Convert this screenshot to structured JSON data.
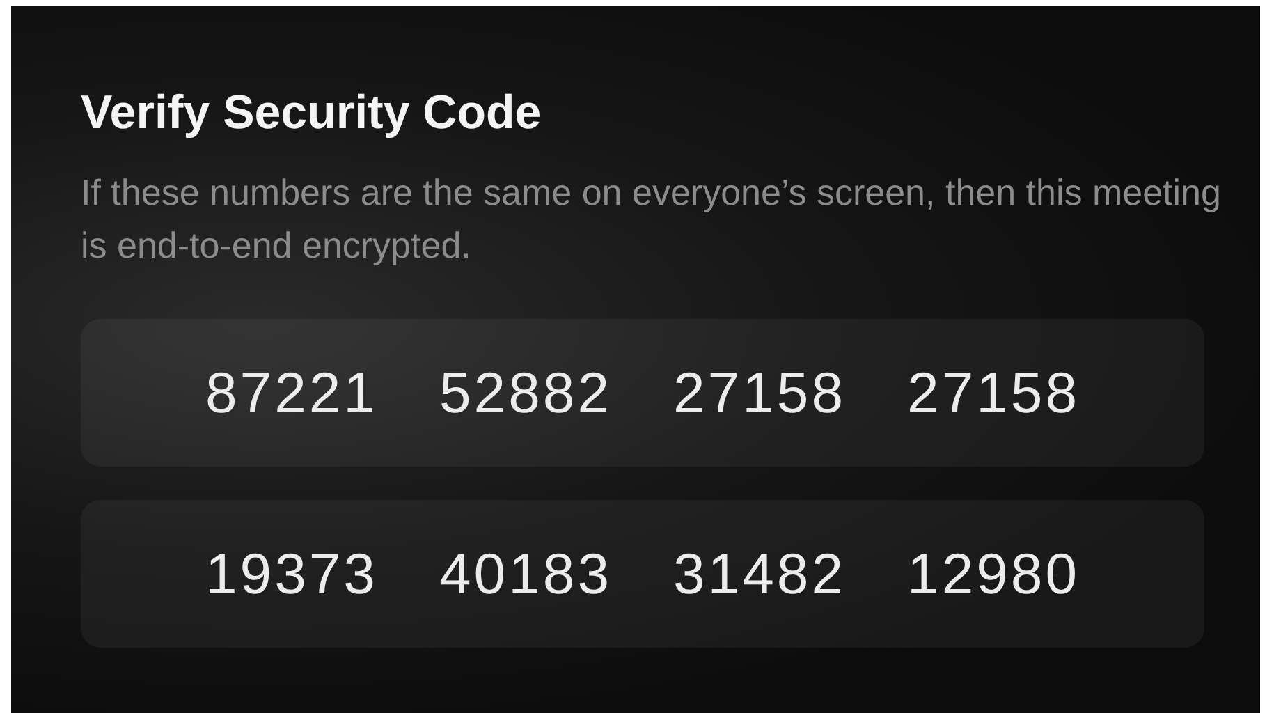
{
  "title": "Verify Security Code",
  "description": "If these numbers are the same on everyone’s screen, then this meeting is end-to-end encrypted.",
  "code_rows": [
    [
      "87221",
      "52882",
      "27158",
      "27158"
    ],
    [
      "19373",
      "40183",
      "31482",
      "12980"
    ]
  ]
}
